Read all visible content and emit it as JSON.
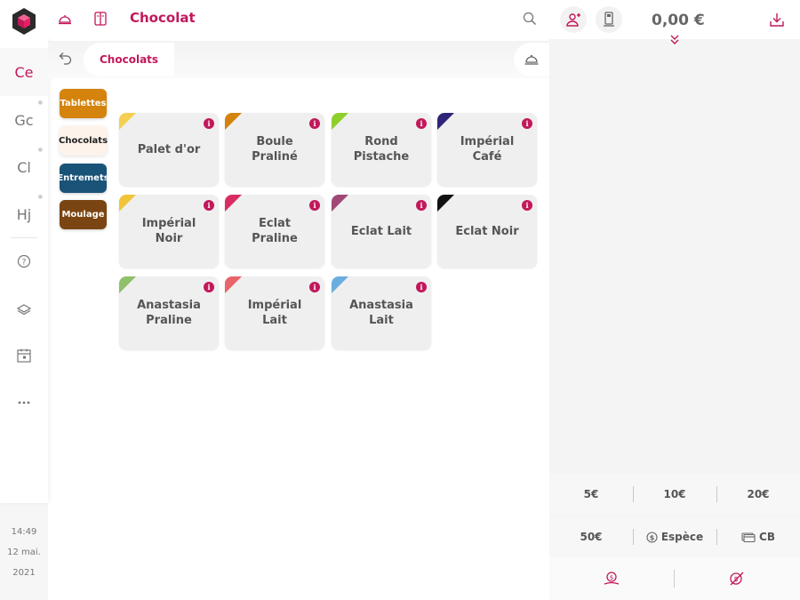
{
  "header": {
    "title": "Chocolat"
  },
  "rail": {
    "users": [
      {
        "label": "Ce",
        "active": true
      },
      {
        "label": "Gc",
        "active": false
      },
      {
        "label": "Cl",
        "active": false
      },
      {
        "label": "Hj",
        "active": false
      }
    ],
    "time": "14:49",
    "date": "12 mai.",
    "year": "2021"
  },
  "breadcrumb": {
    "current": "Chocolats"
  },
  "categories": [
    {
      "label": "Tablettes",
      "color": "#d4830c"
    },
    {
      "label": "Chocolats",
      "color": "#fdf3ea"
    },
    {
      "label": "Entremets",
      "color": "#1a5378"
    },
    {
      "label": "Moulage",
      "color": "#7a4512"
    }
  ],
  "products": [
    {
      "name": "Palet d'or",
      "color": "#f5cf51"
    },
    {
      "name": "Boule Praliné",
      "color": "#d4830c"
    },
    {
      "name": "Rond Pistache",
      "color": "#8fcf2a"
    },
    {
      "name": "Impérial Café",
      "color": "#2e2578"
    },
    {
      "name": "Impérial Noir",
      "color": "#f2c43a"
    },
    {
      "name": "Eclat Praline",
      "color": "#d92c62"
    },
    {
      "name": "Eclat Lait",
      "color": "#a14877"
    },
    {
      "name": "Eclat Noir",
      "color": "#111111"
    },
    {
      "name": "Anastasia Praline",
      "color": "#8fc06a"
    },
    {
      "name": "Impérial Lait",
      "color": "#e8646a"
    },
    {
      "name": "Anastasia Lait",
      "color": "#6aaee0"
    }
  ],
  "order": {
    "total": "0,00 €"
  },
  "payments": {
    "quick": [
      "5€",
      "10€",
      "20€"
    ],
    "amount_50": "50€",
    "cash": "Espèce",
    "card": "CB"
  },
  "accent": "#c2185b"
}
